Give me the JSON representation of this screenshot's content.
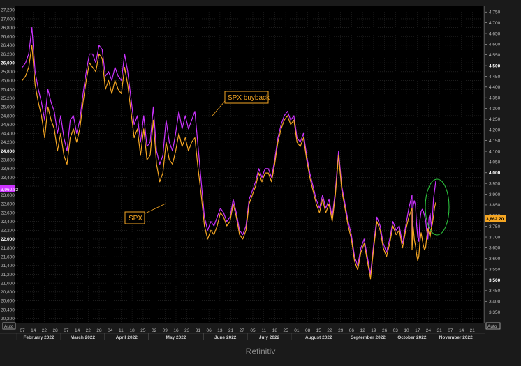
{
  "chart_data": {
    "type": "line",
    "left_axis": {
      "min": 20100,
      "max": 27300,
      "ticks": [
        20200,
        20400,
        20600,
        20800,
        21000,
        21200,
        21400,
        21600,
        21800,
        22000,
        22200,
        22400,
        22600,
        22800,
        23000,
        23200,
        23400,
        23600,
        23800,
        24000,
        24200,
        24400,
        24600,
        24800,
        25000,
        25200,
        25400,
        25600,
        25800,
        26000,
        26200,
        26400,
        26600,
        26800,
        27000,
        27200
      ],
      "tick_labels": [
        "20,200",
        "20,400",
        "20,600",
        "20,800",
        "21,000",
        "21,200",
        "21,400",
        "21,600",
        "21,800",
        "22,000",
        "22,200",
        "22,400",
        "22,600",
        "22,800",
        "23,000",
        "23,200",
        "23,400",
        "23,600",
        "23,800",
        "24,000",
        "24,200",
        "24,400",
        "24,600",
        "24,800",
        "25,000",
        "25,200",
        "25,400",
        "25,600",
        "25,800",
        "26,000",
        "26,200",
        "26,400",
        "26,600",
        "26,800",
        "27,000",
        "27,200"
      ],
      "bold": [
        "22,000",
        "24,000",
        "26,000"
      ],
      "auto_label": "Auto"
    },
    "right_axis": {
      "min": 3300,
      "max": 4780,
      "ticks": [
        3350,
        3400,
        3450,
        3500,
        3550,
        3600,
        3650,
        3700,
        3750,
        3800,
        3850,
        3900,
        3950,
        4000,
        4050,
        4100,
        4150,
        4200,
        4250,
        4300,
        4350,
        4400,
        4450,
        4500,
        4550,
        4600,
        4650,
        4700,
        4750
      ],
      "tick_labels": [
        "3,350",
        "3,400",
        "3,450",
        "3,500",
        "3,550",
        "3,600",
        "3,650",
        "3,700",
        "3,750",
        "3,800",
        "3,850",
        "3,900",
        "3,950",
        "4,000",
        "4,050",
        "4,100",
        "4,150",
        "4,200",
        "4,250",
        "4,300",
        "4,350",
        "4,400",
        "4,450",
        "4,500",
        "4,550",
        "4,600",
        "4,650",
        "4,700",
        "4,750"
      ],
      "bold": [
        "3,500",
        "4,000",
        "4,500"
      ],
      "auto_label": "Auto"
    },
    "x_axis": {
      "day_labels": [
        "07",
        "14",
        "22",
        "28",
        "07",
        "14",
        "22",
        "28",
        "04",
        "11",
        "18",
        "25",
        "02",
        "09",
        "16",
        "23",
        "31",
        "06",
        "13",
        "21",
        "27",
        "05",
        "11",
        "18",
        "25",
        "01",
        "08",
        "15",
        "22",
        "29",
        "06",
        "12",
        "19",
        "26",
        "03",
        "10",
        "17",
        "24",
        "31",
        "07",
        "14",
        "21"
      ],
      "months": [
        "February 2022",
        "March 2022",
        "April 2022",
        "May 2022",
        "June 2022",
        "July 2022",
        "August 2022",
        "September 2022",
        "October 2022",
        "November 2022"
      ]
    },
    "series": [
      {
        "name": "SPX buyback",
        "color": "#cc33ff",
        "last_value_label": "3,960.83",
        "values": [
          25900,
          26000,
          26200,
          26800,
          25800,
          25400,
          25100,
          24700,
          25400,
          25100,
          24900,
          24400,
          24800,
          24300,
          24000,
          24700,
          24800,
          24400,
          24700,
          25300,
          25800,
          26200,
          26200,
          26000,
          26400,
          26300,
          25700,
          25800,
          25600,
          25900,
          25700,
          25600,
          26200,
          25800,
          25200,
          24600,
          24800,
          24200,
          24800,
          24100,
          24200,
          25000,
          24000,
          23700,
          23900,
          24700,
          24200,
          24000,
          24400,
          24900,
          24500,
          24800,
          24500,
          24700,
          24900,
          24100,
          23300,
          22500,
          22200,
          22400,
          22300,
          22500,
          22700,
          22600,
          22400,
          22500,
          22900,
          22600,
          22200,
          22100,
          22300,
          22900,
          23100,
          23300,
          23600,
          23400,
          23600,
          23600,
          23400,
          23800,
          24300,
          24600,
          24800,
          24900,
          24700,
          24800,
          24300,
          24200,
          24400,
          23900,
          23500,
          23200,
          22900,
          22700,
          23000,
          22700,
          22900,
          22500,
          23100,
          24000,
          23200,
          22800,
          22400,
          22100,
          21600,
          21400,
          21800,
          22000,
          21600,
          21200,
          21900,
          22500,
          22300,
          21900,
          21700,
          22000,
          22400,
          22200,
          22300,
          21900,
          22300,
          22700,
          23000
        ],
        "right_values": [
          3660,
          3845,
          3870,
          3850,
          3760,
          3700,
          3680,
          3780,
          3820,
          3830,
          3820,
          3800,
          3780,
          3730,
          3690,
          3790,
          3810,
          3750,
          3790,
          3880,
          3920,
          3962
        ]
      },
      {
        "name": "SPX",
        "color": "#f5a623",
        "last_value_label": "3,862.20",
        "values": [
          25600,
          25700,
          25900,
          26400,
          25500,
          25100,
          24800,
          24300,
          25000,
          24700,
          24500,
          24000,
          24400,
          23900,
          23700,
          24300,
          24500,
          24200,
          24500,
          25100,
          25600,
          26000,
          25900,
          25800,
          26200,
          26100,
          25400,
          25600,
          25300,
          25600,
          25400,
          25300,
          25900,
          25500,
          24900,
          24300,
          24500,
          23900,
          24500,
          23800,
          23900,
          24700,
          23700,
          23300,
          23500,
          24200,
          23800,
          23700,
          24000,
          24400,
          24100,
          24300,
          24000,
          24200,
          24300,
          23600,
          23000,
          22300,
          22000,
          22200,
          22100,
          22300,
          22600,
          22500,
          22300,
          22400,
          22800,
          22500,
          22100,
          22000,
          22200,
          22800,
          23000,
          23200,
          23500,
          23300,
          23500,
          23500,
          23300,
          23700,
          24200,
          24500,
          24700,
          24800,
          24600,
          24700,
          24200,
          24100,
          24300,
          23800,
          23400,
          23100,
          22800,
          22600,
          22900,
          22600,
          22800,
          22400,
          23000,
          23900,
          23100,
          22700,
          22300,
          22000,
          21500,
          21300,
          21700,
          21900,
          21500,
          21100,
          21800,
          22400,
          22200,
          21800,
          21600,
          21900,
          22300,
          22100,
          22200,
          21800,
          22200,
          22500,
          22700
        ],
        "right_values": [
          3640,
          3750,
          3690,
          3660,
          3620,
          3590,
          3610,
          3680,
          3720,
          3690,
          3660,
          3640,
          3650,
          3700,
          3740,
          3720,
          3700,
          3740,
          3760,
          3800,
          3840,
          3862
        ]
      }
    ],
    "annotations": [
      {
        "text": "SPX buyback"
      },
      {
        "text": "SPX"
      }
    ],
    "credit": "Refinitiv"
  }
}
